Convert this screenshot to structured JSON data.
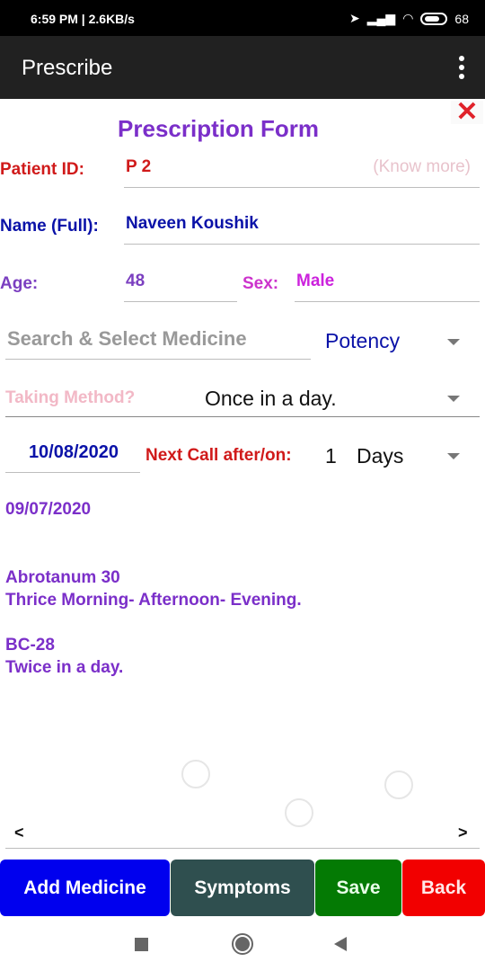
{
  "status_bar": {
    "time": "6:59 PM | 2.6KB/s",
    "battery": "68"
  },
  "app_bar": {
    "title": "Prescribe"
  },
  "form": {
    "title": "Prescription Form",
    "patient_id_label": "Patient ID:",
    "patient_id_value": "P 2",
    "know_more": "(Know more)",
    "name_label": "Name (Full):",
    "name_value": "Naveen Koushik",
    "age_label": "Age:",
    "age_value": "48",
    "sex_label": "Sex:",
    "sex_value": "Male",
    "medicine_search_placeholder": "Search & Select Medicine",
    "potency_value": "Potency",
    "taking_method_label": "Taking Method?",
    "taking_method_value": "Once in a day.",
    "date_value": "10/08/2020",
    "next_call_label": "Next Call after/on:",
    "next_call_number": "1",
    "next_call_unit": "Days"
  },
  "prescription": {
    "date": "09/07/2020",
    "items": [
      {
        "name": "Abrotanum 30",
        "dosage": "Thrice Morning- Afternoon- Evening."
      },
      {
        "name": "BC-28",
        "dosage": "Twice in a day."
      }
    ]
  },
  "pager": {
    "prev": "<",
    "next": ">"
  },
  "buttons": {
    "add_medicine": "Add Medicine",
    "symptoms": "Symptoms",
    "save": "Save",
    "back": "Back"
  },
  "colors": {
    "add_medicine": "#0000ee",
    "symptoms": "#2f4f4f",
    "save": "#047a04",
    "back": "#f20000",
    "title": "#7b2fc9"
  }
}
